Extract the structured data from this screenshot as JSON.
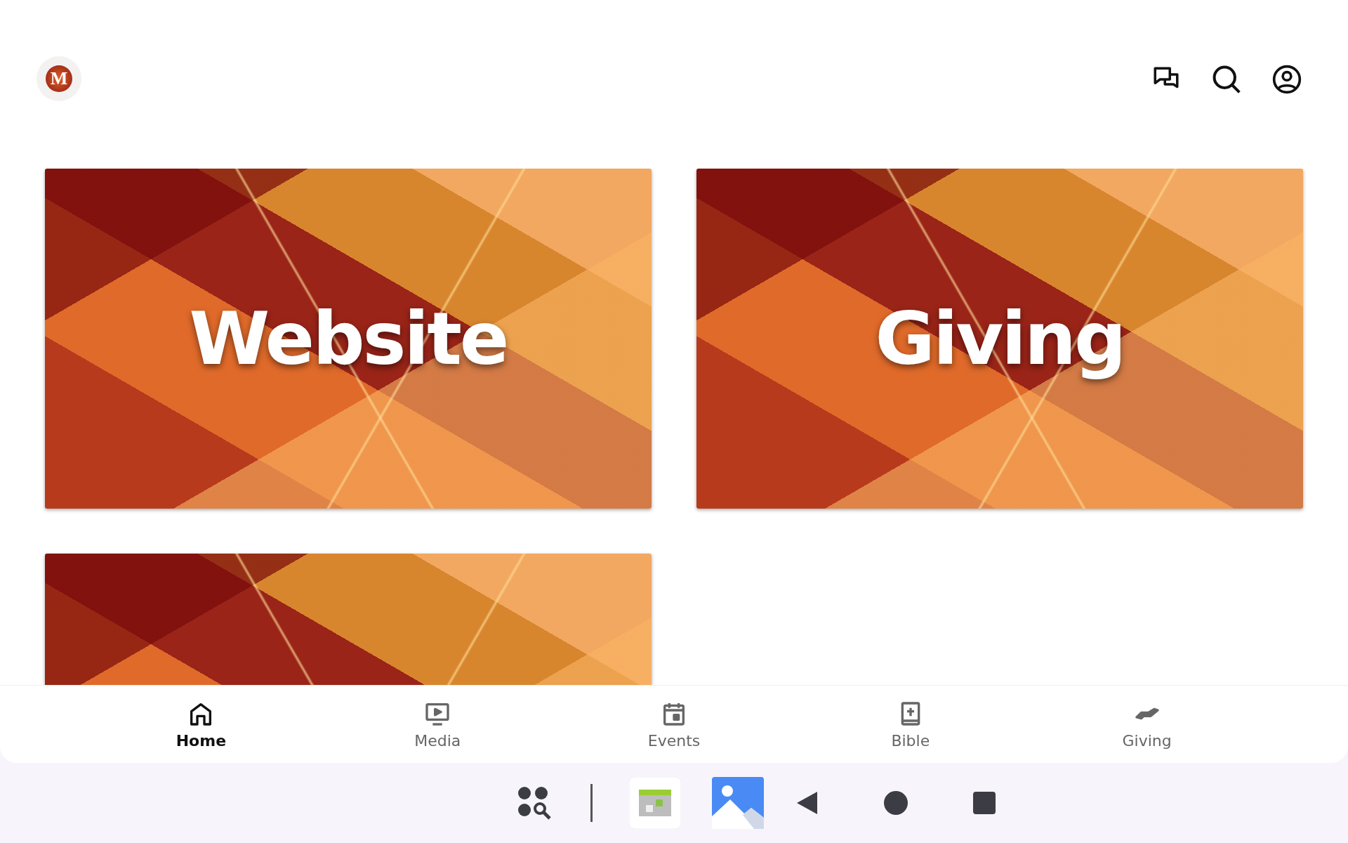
{
  "header": {
    "logo_letter": "M"
  },
  "tiles": [
    {
      "kind": "titled",
      "title": "Website"
    },
    {
      "kind": "titled",
      "title": "Giving"
    },
    {
      "kind": "image"
    }
  ],
  "bottom_nav": [
    {
      "label": "Home",
      "kind": "home",
      "selected": true
    },
    {
      "label": "Media",
      "kind": "media",
      "selected": false
    },
    {
      "label": "Events",
      "kind": "events",
      "selected": false
    },
    {
      "label": "Bible",
      "kind": "bible",
      "selected": false
    },
    {
      "label": "Giving",
      "kind": "giving",
      "selected": false
    }
  ]
}
